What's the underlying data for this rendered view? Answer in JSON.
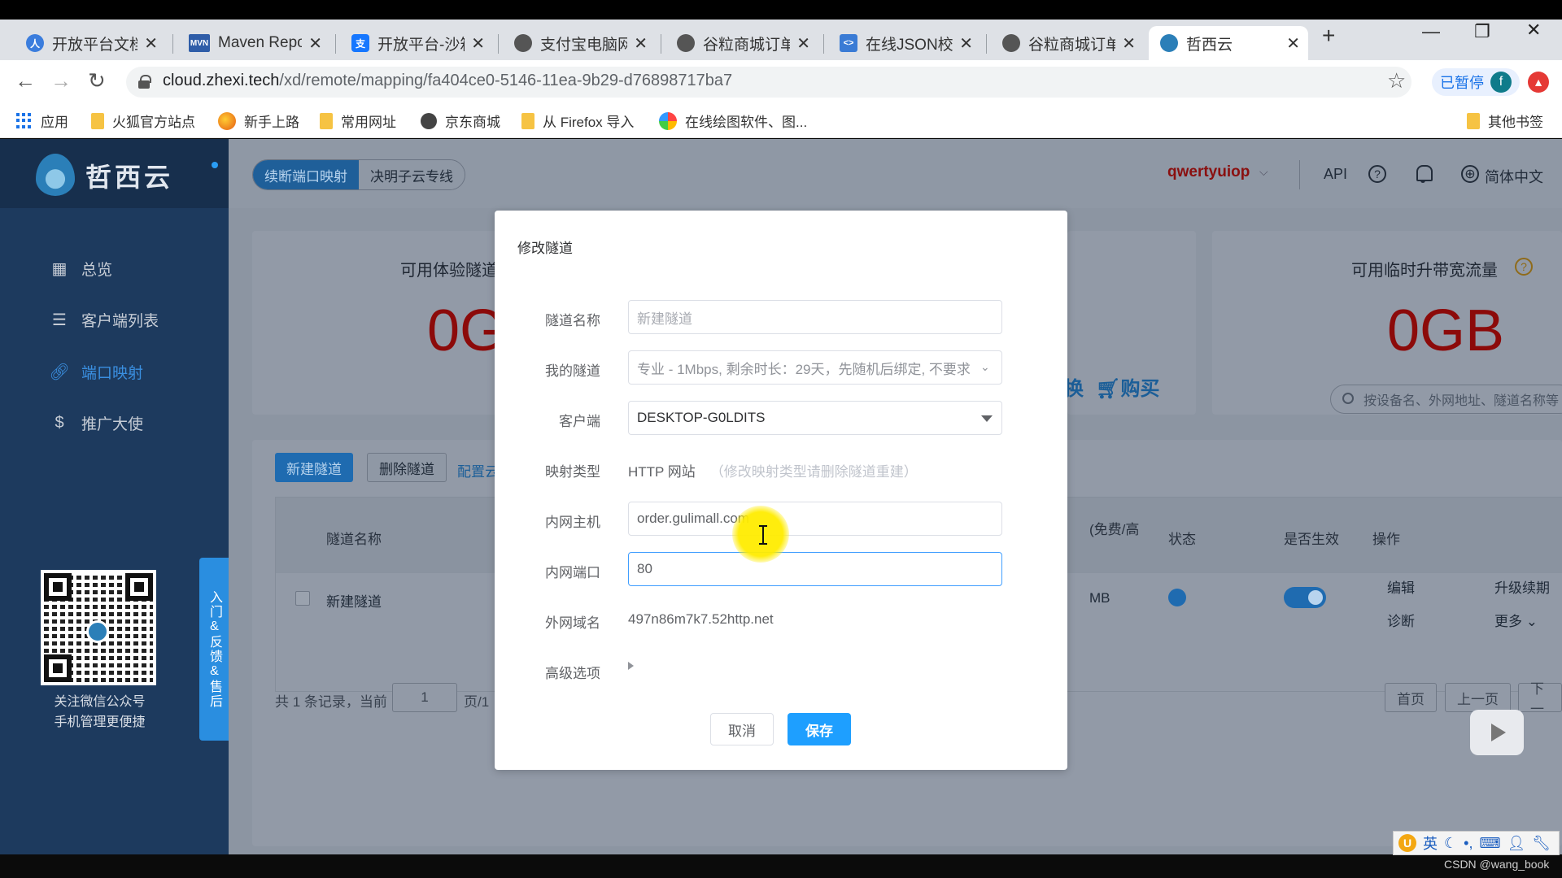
{
  "browser": {
    "tabs": [
      {
        "label": "开放平台文档中",
        "icon_color": "#3b7ddd",
        "icon": "person-icon"
      },
      {
        "label": "Maven Repos",
        "icon_color": "#2f5da8",
        "icon": "maven-icon"
      },
      {
        "label": "开放平台-沙箱",
        "icon_color": "#1677ff",
        "icon": "alipay-icon"
      },
      {
        "label": "支付宝电脑网站",
        "icon_color": "#555555",
        "icon": "globe-icon"
      },
      {
        "label": "谷粒商城订单",
        "icon_color": "#555555",
        "icon": "globe-icon"
      },
      {
        "label": "在线JSON校验",
        "icon_color": "#3a7bd5",
        "icon": "code-icon"
      },
      {
        "label": "谷粒商城订单",
        "icon_color": "#555555",
        "icon": "globe-icon"
      },
      {
        "label": "哲西云",
        "icon_color": "#2b7fb8",
        "icon": "logo-icon",
        "active": true
      }
    ],
    "url_host": "cloud.zhexi.tech",
    "url_path": "/xd/remote/mapping/fa404ce0-5146-11ea-9b29-d76898717ba7",
    "paused_label": "已暂停",
    "profile_initial": "f",
    "bookmarks": [
      "应用",
      "火狐官方站点",
      "新手上路",
      "常用网址",
      "京东商城",
      "从 Firefox 导入",
      "在线绘图软件、图...",
      "其他书签"
    ]
  },
  "app": {
    "brand": "哲西云",
    "nav": [
      {
        "label": "总览",
        "icon": "grid-icon"
      },
      {
        "label": "客户端列表",
        "icon": "server-icon"
      },
      {
        "label": "端口映射",
        "icon": "link-icon",
        "active": true
      },
      {
        "label": "推广大使",
        "icon": "dollar-icon"
      }
    ],
    "qr_caption_1": "关注微信公众号",
    "qr_caption_2": "手机管理更便捷",
    "feedback_tab": "入门&反馈&售后",
    "segment": [
      "续断端口映射",
      "决明子云专线"
    ],
    "user": "qwertyuiop",
    "top_links": {
      "api": "API",
      "language": "简体中文"
    },
    "cards": {
      "left_title": "可用体验隧道",
      "left_value": "0G",
      "mid_action_left": "换",
      "mid_action_buy": "购买",
      "right_title": "可用临时升带宽流量",
      "right_value": "0GB"
    },
    "toolbar": {
      "new_tunnel": "新建隧道",
      "delete_tunnel": "删除隧道",
      "config_link": "配置云",
      "search_placeholder": "按设备名、外网地址、隧道名称等"
    },
    "table": {
      "headers": {
        "name": "隧道名称",
        "plan": "(免费/高",
        "status": "状态",
        "enabled": "是否生效",
        "actions": "操作"
      },
      "row": {
        "name": "新建隧道",
        "traffic": "MB",
        "edit": "编辑",
        "upgrade": "升级续期",
        "diagnose": "诊断",
        "more": "更多"
      }
    },
    "pager": {
      "summary": "共 1 条记录，当前",
      "page": "1",
      "page_total": "页/1",
      "first": "首页",
      "prev": "上一页",
      "next": "下一"
    }
  },
  "modal": {
    "title": "修改隧道",
    "fields": {
      "name_label": "隧道名称",
      "name_placeholder": "新建隧道",
      "tunnel_label": "我的隧道",
      "tunnel_value": "专业 - 1Mbps, 剩余时长：29天，先随机后绑定, 不要求",
      "client_label": "客户端",
      "client_value": "DESKTOP-G0LDITS",
      "type_label": "映射类型",
      "type_value": "HTTP 网站",
      "type_hint": "（修改映射类型请删除隧道重建）",
      "host_label": "内网主机",
      "host_value": "order.gulimall.com",
      "port_label": "内网端口",
      "port_value": "80",
      "domain_label": "外网域名",
      "domain_value": "497n86m7k7.52http.net",
      "advanced_label": "高级选项"
    },
    "cancel": "取消",
    "save": "保存"
  },
  "system": {
    "ime_lang": "英",
    "watermark": "CSDN @wang_book"
  }
}
